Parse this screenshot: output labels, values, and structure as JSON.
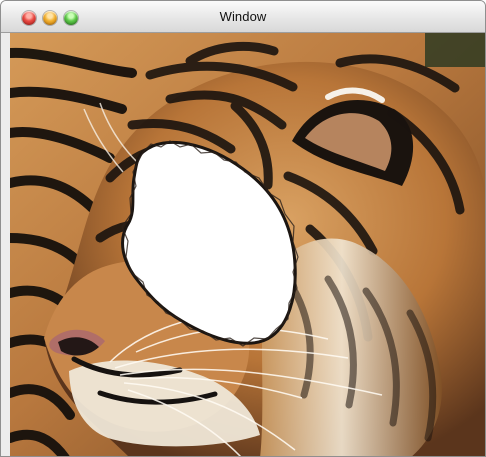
{
  "window": {
    "title": "Window",
    "controls": {
      "close": "close-icon",
      "minimize": "minimize-icon",
      "zoom": "zoom-icon"
    }
  },
  "image": {
    "subject": "tiger",
    "mask_color": "#ffffff",
    "colors": {
      "fur": "#c98a43",
      "dark_stripes": "#14100c",
      "light_fur": "#f3ead9",
      "nose": "#b06e68",
      "background": "#2f3b22"
    }
  }
}
